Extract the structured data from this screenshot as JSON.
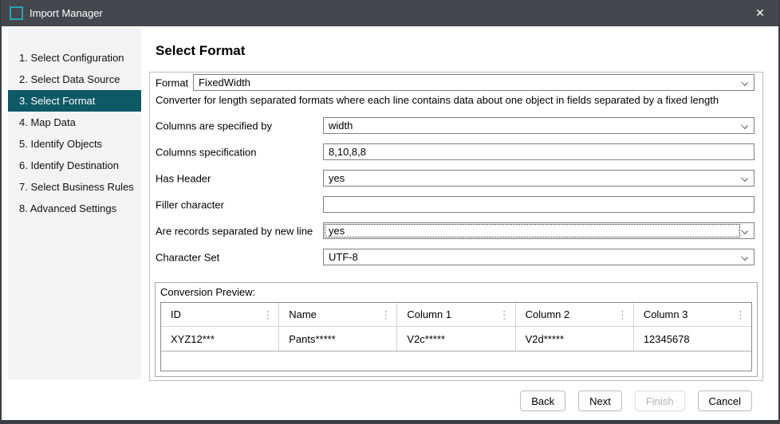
{
  "window": {
    "title": "Import Manager",
    "close_glyph": "✕"
  },
  "sidebar": {
    "items": [
      {
        "label": "1. Select Configuration",
        "selected": false
      },
      {
        "label": "2. Select Data Source",
        "selected": false
      },
      {
        "label": "3. Select Format",
        "selected": true
      },
      {
        "label": "4. Map Data",
        "selected": false
      },
      {
        "label": "5. Identify Objects",
        "selected": false
      },
      {
        "label": "6. Identify Destination",
        "selected": false
      },
      {
        "label": "7. Select Business Rules",
        "selected": false
      },
      {
        "label": "8. Advanced Settings",
        "selected": false
      }
    ]
  },
  "main": {
    "heading": "Select Format",
    "format_row": {
      "label": "Format",
      "value": "FixedWidth"
    },
    "description": "Converter for length separated formats where each line contains data about one object in fields separated by a fixed length",
    "fields": [
      {
        "label": "Columns are specified by",
        "value": "width",
        "type": "select",
        "focused": false
      },
      {
        "label": "Columns specification",
        "value": "8,10,8,8",
        "type": "text",
        "focused": false
      },
      {
        "label": "Has Header",
        "value": "yes",
        "type": "select",
        "focused": false
      },
      {
        "label": "Filler character",
        "value": "",
        "type": "text",
        "focused": false
      },
      {
        "label": "Are records separated by new line",
        "value": "yes",
        "type": "select",
        "focused": true
      },
      {
        "label": "Character Set",
        "value": "UTF-8",
        "type": "select",
        "focused": false
      }
    ],
    "preview": {
      "title": "Conversion Preview:",
      "menu_glyph": "⋮",
      "columns": [
        "ID",
        "Name",
        "Column 1",
        "Column 2",
        "Column 3"
      ],
      "rows": [
        [
          "XYZ12***",
          "Pants*****",
          "V2c*****",
          "V2d*****",
          "12345678"
        ]
      ]
    }
  },
  "footer": {
    "buttons": [
      {
        "label": "Back",
        "enabled": true
      },
      {
        "label": "Next",
        "enabled": true
      },
      {
        "label": "Finish",
        "enabled": false
      },
      {
        "label": "Cancel",
        "enabled": true
      }
    ]
  },
  "colors": {
    "titlebar_bg": "#44484c",
    "selected_step_bg": "#0e5966",
    "app_icon_teal": "#29a4b2"
  }
}
